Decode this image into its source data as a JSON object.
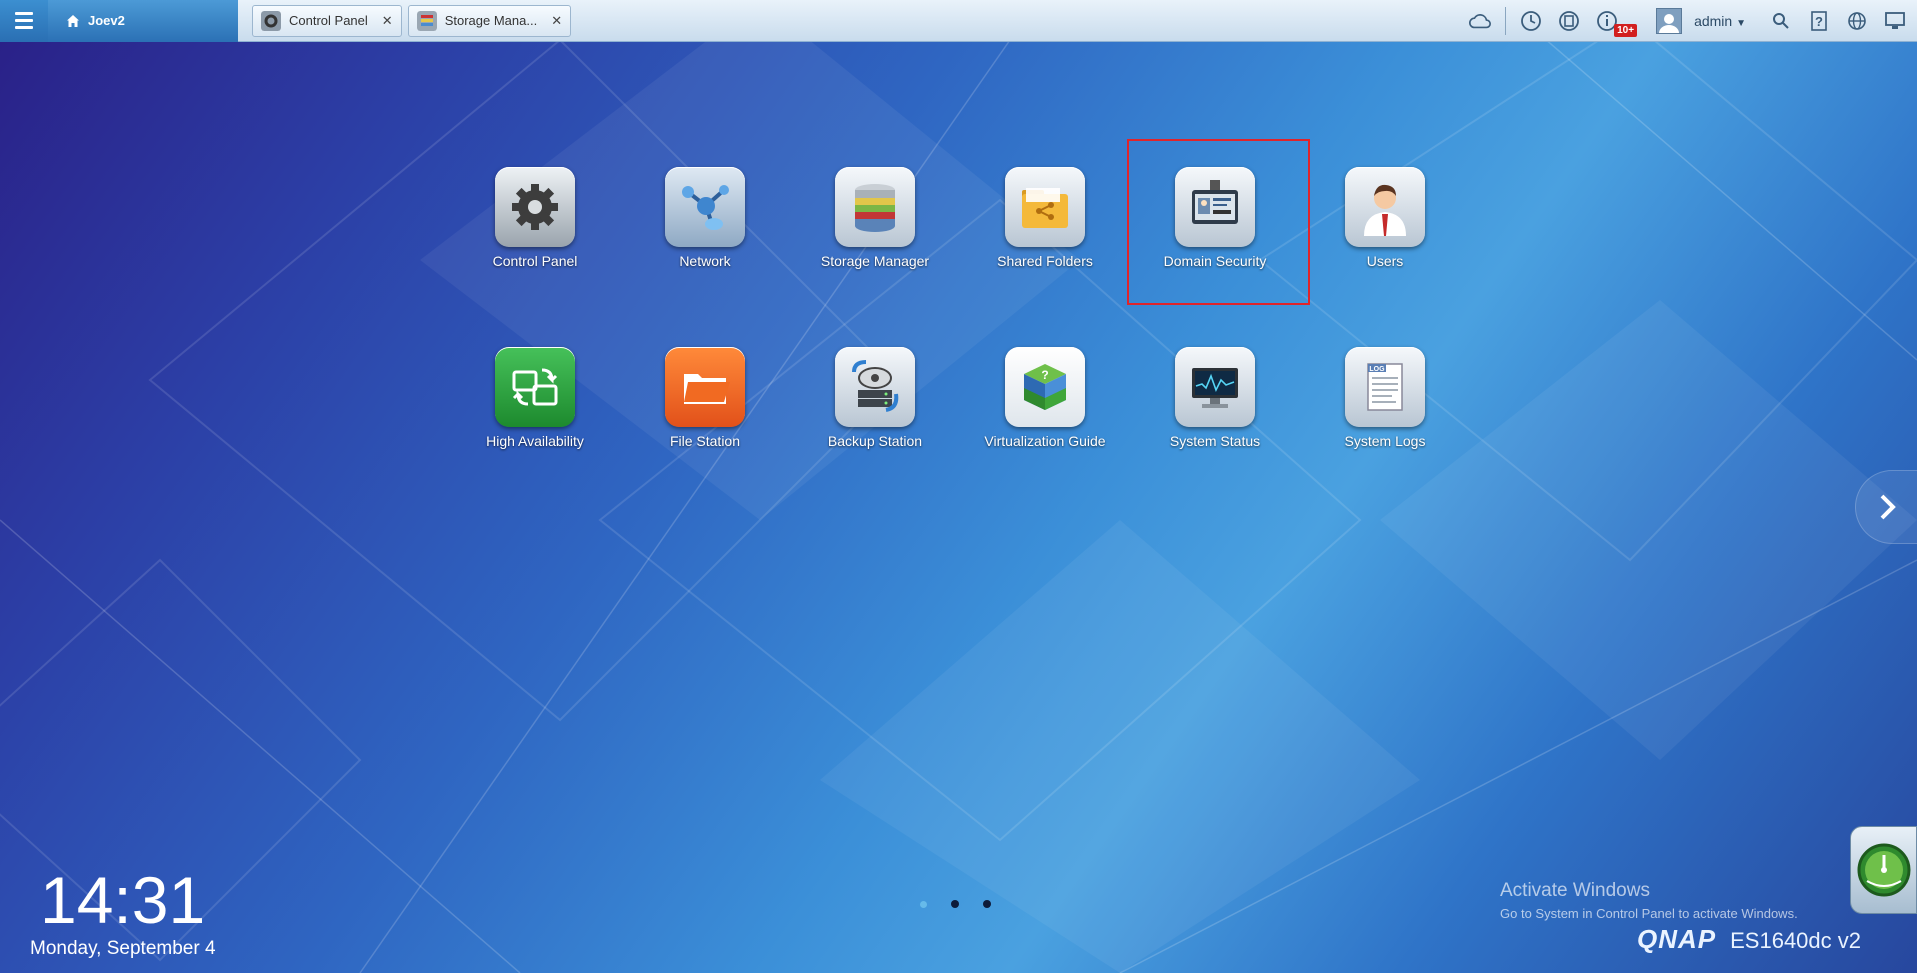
{
  "topbar": {
    "home_label": "Joev2",
    "tabs": [
      {
        "label": "Control Panel"
      },
      {
        "label": "Storage Mana..."
      }
    ],
    "notification_badge": "10+",
    "user": "admin"
  },
  "apps": [
    {
      "label": "Control Panel",
      "icon": "gear-icon"
    },
    {
      "label": "Network",
      "icon": "network-icon"
    },
    {
      "label": "Storage Manager",
      "icon": "disk-stack-icon"
    },
    {
      "label": "Shared Folders",
      "icon": "shared-folder-icon"
    },
    {
      "label": "Domain Security",
      "icon": "id-badge-icon"
    },
    {
      "label": "Users",
      "icon": "user-icon"
    },
    {
      "label": "High Availability",
      "icon": "sync-icon"
    },
    {
      "label": "File Station",
      "icon": "folder-icon"
    },
    {
      "label": "Backup Station",
      "icon": "backup-icon"
    },
    {
      "label": "Virtualization Guide",
      "icon": "cube-icon"
    },
    {
      "label": "System Status",
      "icon": "monitor-icon"
    },
    {
      "label": "System Logs",
      "icon": "log-icon"
    }
  ],
  "desktop": {
    "time": "14:31",
    "date": "Monday, September 4",
    "activate_title": "Activate Windows",
    "activate_sub": "Go to System in Control Panel to activate Windows.",
    "brand": "QNAP",
    "model": "ES1640dc v2"
  },
  "colors": {
    "accent": "#2a6fb3",
    "highlight": "#e0242b",
    "badge": "#d21f1f"
  }
}
